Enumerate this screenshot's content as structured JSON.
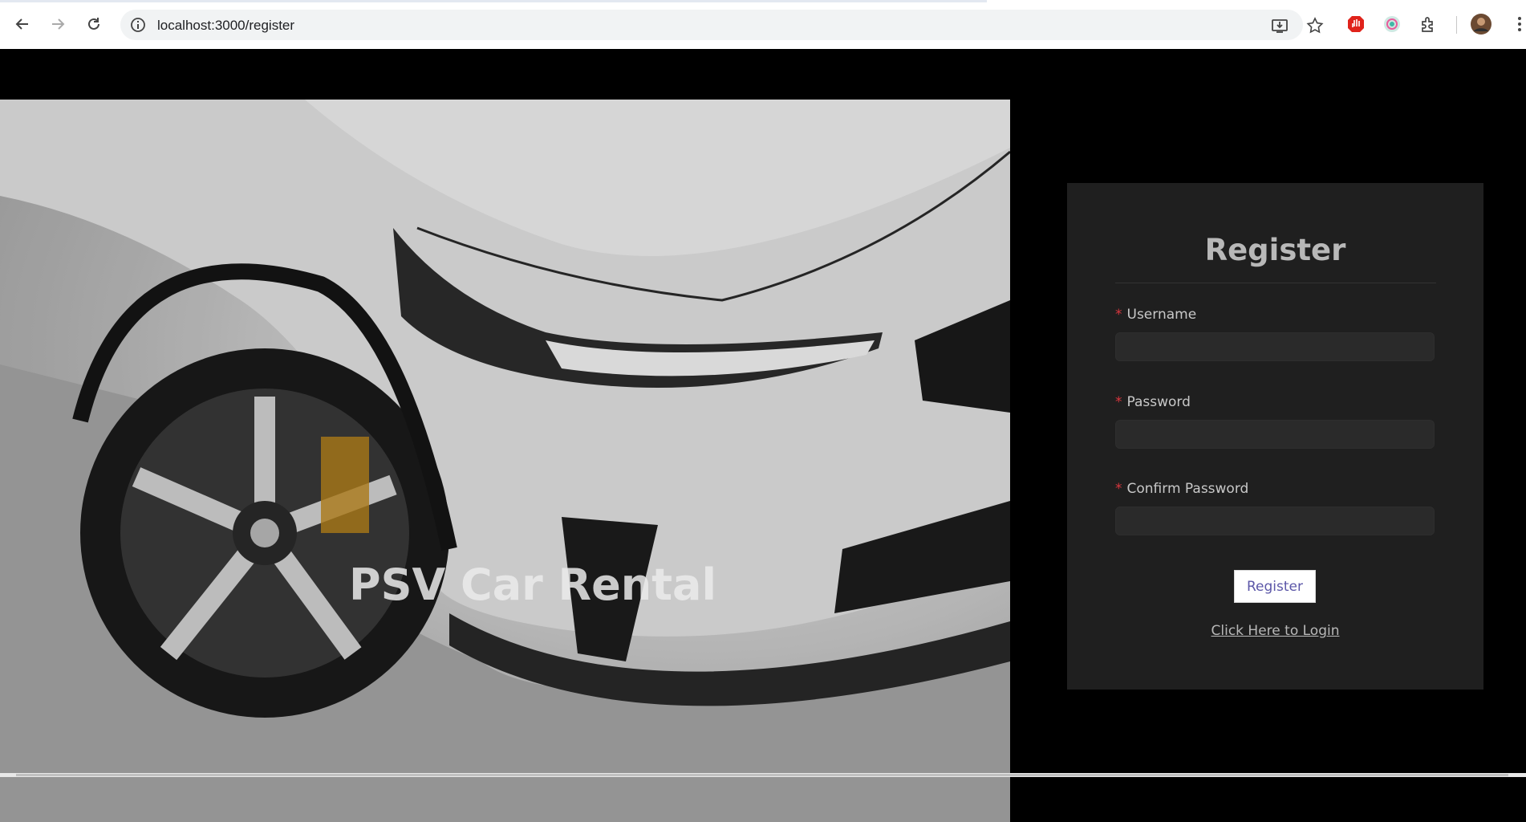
{
  "browser": {
    "url": "localhost:3000/register",
    "icons": {
      "back": "back-arrow-icon",
      "forward": "forward-arrow-icon",
      "reload": "reload-icon",
      "info": "site-info-icon",
      "install": "install-app-icon",
      "bookmark": "bookmark-star-icon",
      "extensions": "extensions-puzzle-icon",
      "menu": "kebab-menu-icon"
    }
  },
  "hero": {
    "brand": "PSV Car Rental"
  },
  "form": {
    "title": "Register",
    "fields": [
      {
        "label": "Username",
        "required_mark": "*",
        "value": ""
      },
      {
        "label": "Password",
        "required_mark": "*",
        "value": ""
      },
      {
        "label": "Confirm Password",
        "required_mark": "*",
        "value": ""
      }
    ],
    "submit_label": "Register",
    "login_link": "Click Here to Login"
  },
  "colors": {
    "background": "#000000",
    "panel": "#1f1f1f",
    "required": "#d9363e",
    "button_text": "#5c57a8"
  }
}
